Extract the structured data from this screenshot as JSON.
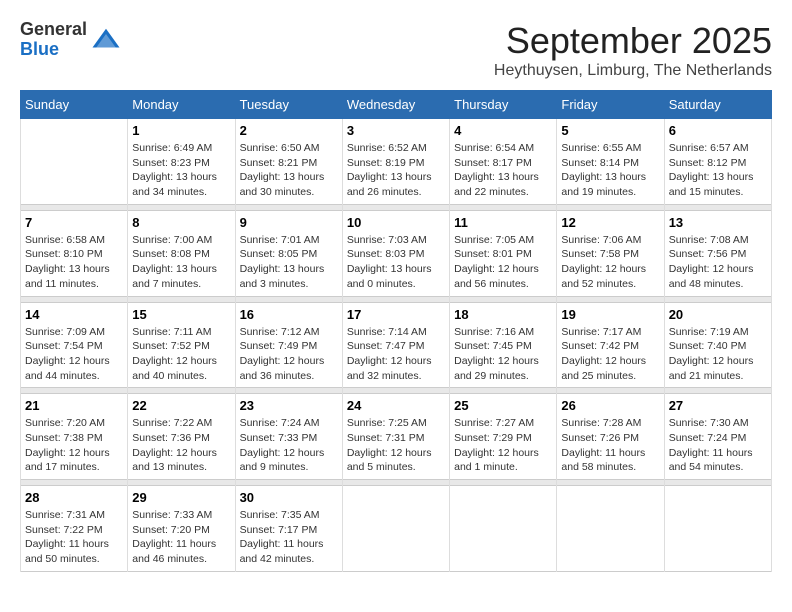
{
  "header": {
    "logo_general": "General",
    "logo_blue": "Blue",
    "month_title": "September 2025",
    "location": "Heythuysen, Limburg, The Netherlands"
  },
  "days_of_week": [
    "Sunday",
    "Monday",
    "Tuesday",
    "Wednesday",
    "Thursday",
    "Friday",
    "Saturday"
  ],
  "weeks": [
    [
      {
        "num": "",
        "sunrise": "",
        "sunset": "",
        "daylight": ""
      },
      {
        "num": "1",
        "sunrise": "Sunrise: 6:49 AM",
        "sunset": "Sunset: 8:23 PM",
        "daylight": "Daylight: 13 hours and 34 minutes."
      },
      {
        "num": "2",
        "sunrise": "Sunrise: 6:50 AM",
        "sunset": "Sunset: 8:21 PM",
        "daylight": "Daylight: 13 hours and 30 minutes."
      },
      {
        "num": "3",
        "sunrise": "Sunrise: 6:52 AM",
        "sunset": "Sunset: 8:19 PM",
        "daylight": "Daylight: 13 hours and 26 minutes."
      },
      {
        "num": "4",
        "sunrise": "Sunrise: 6:54 AM",
        "sunset": "Sunset: 8:17 PM",
        "daylight": "Daylight: 13 hours and 22 minutes."
      },
      {
        "num": "5",
        "sunrise": "Sunrise: 6:55 AM",
        "sunset": "Sunset: 8:14 PM",
        "daylight": "Daylight: 13 hours and 19 minutes."
      },
      {
        "num": "6",
        "sunrise": "Sunrise: 6:57 AM",
        "sunset": "Sunset: 8:12 PM",
        "daylight": "Daylight: 13 hours and 15 minutes."
      }
    ],
    [
      {
        "num": "7",
        "sunrise": "Sunrise: 6:58 AM",
        "sunset": "Sunset: 8:10 PM",
        "daylight": "Daylight: 13 hours and 11 minutes."
      },
      {
        "num": "8",
        "sunrise": "Sunrise: 7:00 AM",
        "sunset": "Sunset: 8:08 PM",
        "daylight": "Daylight: 13 hours and 7 minutes."
      },
      {
        "num": "9",
        "sunrise": "Sunrise: 7:01 AM",
        "sunset": "Sunset: 8:05 PM",
        "daylight": "Daylight: 13 hours and 3 minutes."
      },
      {
        "num": "10",
        "sunrise": "Sunrise: 7:03 AM",
        "sunset": "Sunset: 8:03 PM",
        "daylight": "Daylight: 13 hours and 0 minutes."
      },
      {
        "num": "11",
        "sunrise": "Sunrise: 7:05 AM",
        "sunset": "Sunset: 8:01 PM",
        "daylight": "Daylight: 12 hours and 56 minutes."
      },
      {
        "num": "12",
        "sunrise": "Sunrise: 7:06 AM",
        "sunset": "Sunset: 7:58 PM",
        "daylight": "Daylight: 12 hours and 52 minutes."
      },
      {
        "num": "13",
        "sunrise": "Sunrise: 7:08 AM",
        "sunset": "Sunset: 7:56 PM",
        "daylight": "Daylight: 12 hours and 48 minutes."
      }
    ],
    [
      {
        "num": "14",
        "sunrise": "Sunrise: 7:09 AM",
        "sunset": "Sunset: 7:54 PM",
        "daylight": "Daylight: 12 hours and 44 minutes."
      },
      {
        "num": "15",
        "sunrise": "Sunrise: 7:11 AM",
        "sunset": "Sunset: 7:52 PM",
        "daylight": "Daylight: 12 hours and 40 minutes."
      },
      {
        "num": "16",
        "sunrise": "Sunrise: 7:12 AM",
        "sunset": "Sunset: 7:49 PM",
        "daylight": "Daylight: 12 hours and 36 minutes."
      },
      {
        "num": "17",
        "sunrise": "Sunrise: 7:14 AM",
        "sunset": "Sunset: 7:47 PM",
        "daylight": "Daylight: 12 hours and 32 minutes."
      },
      {
        "num": "18",
        "sunrise": "Sunrise: 7:16 AM",
        "sunset": "Sunset: 7:45 PM",
        "daylight": "Daylight: 12 hours and 29 minutes."
      },
      {
        "num": "19",
        "sunrise": "Sunrise: 7:17 AM",
        "sunset": "Sunset: 7:42 PM",
        "daylight": "Daylight: 12 hours and 25 minutes."
      },
      {
        "num": "20",
        "sunrise": "Sunrise: 7:19 AM",
        "sunset": "Sunset: 7:40 PM",
        "daylight": "Daylight: 12 hours and 21 minutes."
      }
    ],
    [
      {
        "num": "21",
        "sunrise": "Sunrise: 7:20 AM",
        "sunset": "Sunset: 7:38 PM",
        "daylight": "Daylight: 12 hours and 17 minutes."
      },
      {
        "num": "22",
        "sunrise": "Sunrise: 7:22 AM",
        "sunset": "Sunset: 7:36 PM",
        "daylight": "Daylight: 12 hours and 13 minutes."
      },
      {
        "num": "23",
        "sunrise": "Sunrise: 7:24 AM",
        "sunset": "Sunset: 7:33 PM",
        "daylight": "Daylight: 12 hours and 9 minutes."
      },
      {
        "num": "24",
        "sunrise": "Sunrise: 7:25 AM",
        "sunset": "Sunset: 7:31 PM",
        "daylight": "Daylight: 12 hours and 5 minutes."
      },
      {
        "num": "25",
        "sunrise": "Sunrise: 7:27 AM",
        "sunset": "Sunset: 7:29 PM",
        "daylight": "Daylight: 12 hours and 1 minute."
      },
      {
        "num": "26",
        "sunrise": "Sunrise: 7:28 AM",
        "sunset": "Sunset: 7:26 PM",
        "daylight": "Daylight: 11 hours and 58 minutes."
      },
      {
        "num": "27",
        "sunrise": "Sunrise: 7:30 AM",
        "sunset": "Sunset: 7:24 PM",
        "daylight": "Daylight: 11 hours and 54 minutes."
      }
    ],
    [
      {
        "num": "28",
        "sunrise": "Sunrise: 7:31 AM",
        "sunset": "Sunset: 7:22 PM",
        "daylight": "Daylight: 11 hours and 50 minutes."
      },
      {
        "num": "29",
        "sunrise": "Sunrise: 7:33 AM",
        "sunset": "Sunset: 7:20 PM",
        "daylight": "Daylight: 11 hours and 46 minutes."
      },
      {
        "num": "30",
        "sunrise": "Sunrise: 7:35 AM",
        "sunset": "Sunset: 7:17 PM",
        "daylight": "Daylight: 11 hours and 42 minutes."
      },
      {
        "num": "",
        "sunrise": "",
        "sunset": "",
        "daylight": ""
      },
      {
        "num": "",
        "sunrise": "",
        "sunset": "",
        "daylight": ""
      },
      {
        "num": "",
        "sunrise": "",
        "sunset": "",
        "daylight": ""
      },
      {
        "num": "",
        "sunrise": "",
        "sunset": "",
        "daylight": ""
      }
    ]
  ]
}
